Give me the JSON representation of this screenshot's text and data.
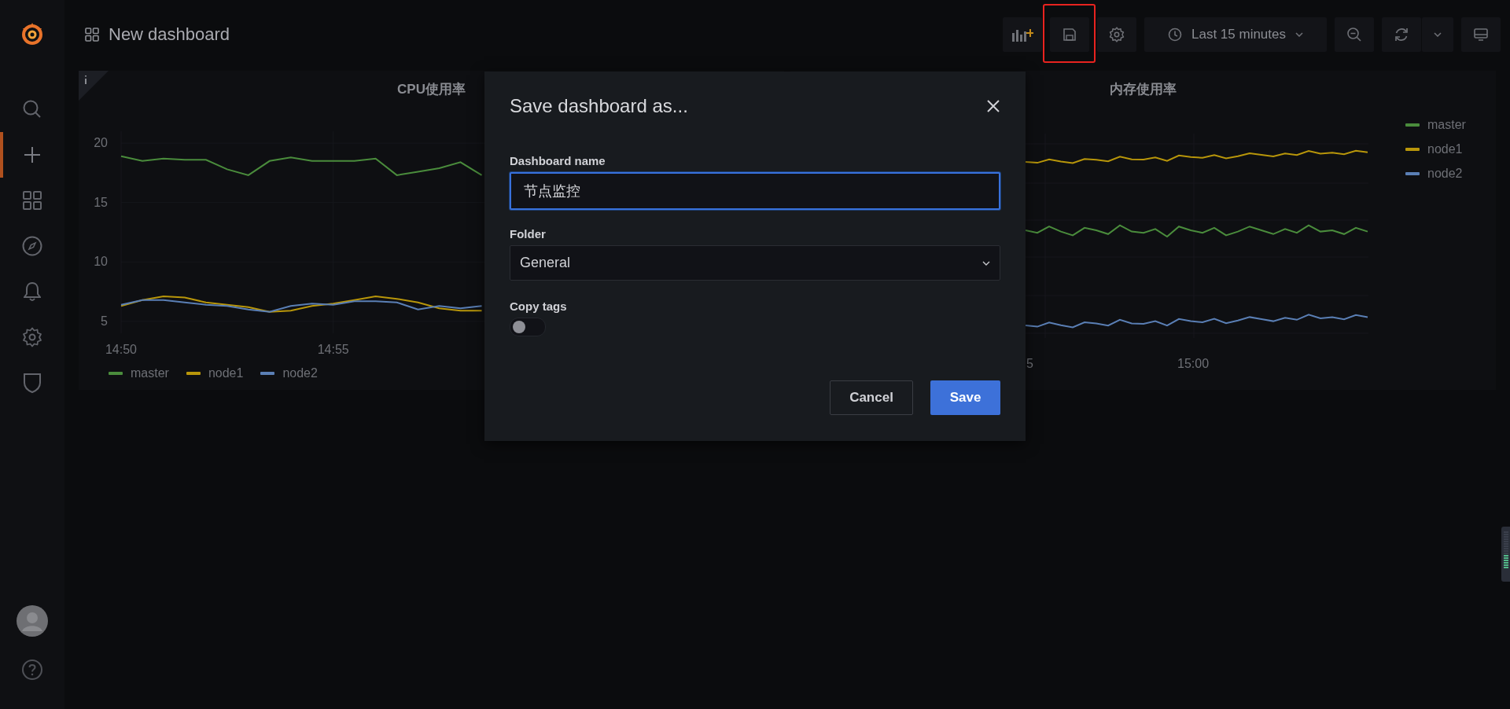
{
  "sidebar": {
    "items": [
      {
        "kind": "search",
        "selected": false
      },
      {
        "kind": "create",
        "selected": true
      },
      {
        "kind": "dashboards",
        "selected": false
      },
      {
        "kind": "explore",
        "selected": false
      },
      {
        "kind": "alerting",
        "selected": false
      },
      {
        "kind": "configuration",
        "selected": false
      },
      {
        "kind": "shield",
        "selected": false
      }
    ],
    "bottom": [
      {
        "kind": "avatar"
      },
      {
        "kind": "help"
      }
    ]
  },
  "header": {
    "title": "New dashboard",
    "toolbar": [
      {
        "kind": "add-panel",
        "highlighted": false
      },
      {
        "kind": "save",
        "highlighted": true
      },
      {
        "kind": "settings",
        "highlighted": false
      },
      {
        "kind": "time-picker",
        "label": "Last 15 minutes",
        "highlighted": false
      },
      {
        "kind": "zoom-out",
        "highlighted": false
      },
      {
        "kind": "refresh",
        "highlighted": false
      },
      {
        "kind": "tv-mode",
        "highlighted": false
      }
    ]
  },
  "panels": [
    {
      "title": "CPU使用率",
      "chart_data": {
        "type": "line",
        "grid": true,
        "categories": [
          "14:50",
          null,
          null,
          null,
          null,
          null,
          null,
          null,
          null,
          null,
          "14:55",
          null,
          null,
          null,
          null,
          null,
          null,
          null
        ],
        "ylim": [
          4,
          21
        ],
        "yticks": [
          5,
          10,
          15,
          20
        ],
        "series": [
          {
            "name": "master",
            "color": "#4a8c3c",
            "values": [
              18.9,
              18.5,
              18.7,
              18.6,
              18.6,
              17.8,
              17.3,
              18.5,
              18.8,
              18.5,
              18.5,
              18.5,
              18.7,
              17.3,
              17.6,
              17.9,
              18.4,
              17.3
            ]
          },
          {
            "name": "node1",
            "color": "#b8960a",
            "values": [
              6.3,
              6.8,
              7.1,
              7.0,
              6.6,
              6.4,
              6.2,
              5.8,
              5.9,
              6.3,
              6.5,
              6.8,
              7.1,
              6.9,
              6.6,
              6.1,
              5.9,
              5.9
            ]
          },
          {
            "name": "node2",
            "color": "#5a7fb5",
            "values": [
              6.4,
              6.8,
              6.8,
              6.6,
              6.4,
              6.3,
              6.0,
              5.8,
              6.3,
              6.5,
              6.4,
              6.7,
              6.7,
              6.6,
              6.0,
              6.3,
              6.1,
              6.3
            ]
          }
        ]
      }
    },
    {
      "title": "内存使用率",
      "x_labels": [
        "5",
        "15:00"
      ],
      "legend": [
        {
          "name": "master",
          "color": "#4a8c3c"
        },
        {
          "name": "node1",
          "color": "#b8960a"
        },
        {
          "name": "node2",
          "color": "#5a7fb5"
        }
      ]
    }
  ],
  "modal": {
    "title": "Save dashboard as...",
    "name_field": {
      "label": "Dashboard name",
      "value": "节点监控",
      "focused": true
    },
    "folder_field": {
      "label": "Folder",
      "value": "General"
    },
    "copy_tags": {
      "label": "Copy tags",
      "on": false
    },
    "buttons": [
      {
        "label": "Cancel",
        "kind": "secondary"
      },
      {
        "label": "Save",
        "kind": "primary"
      }
    ]
  }
}
